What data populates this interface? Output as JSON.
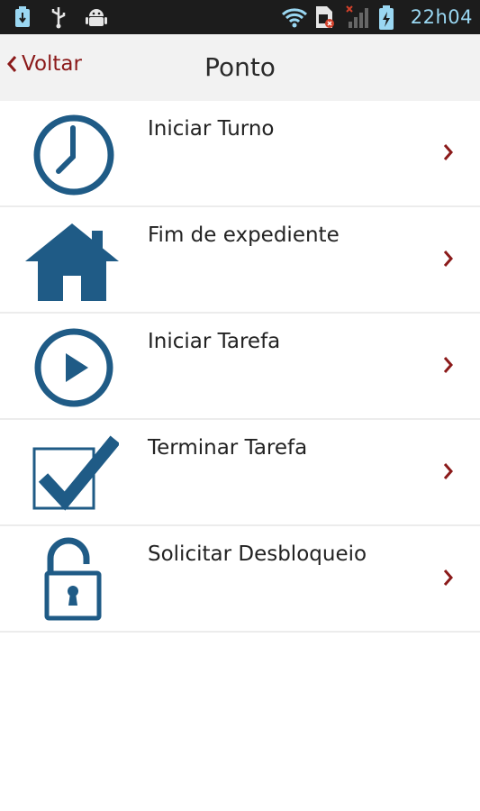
{
  "status_bar": {
    "time": "22h04",
    "icons": [
      "usb-storage-icon",
      "usb-icon",
      "android-debug-icon",
      "wifi-icon",
      "sim-error-icon",
      "signal-no-service-icon",
      "battery-charging-icon"
    ]
  },
  "header": {
    "back_label": "Voltar",
    "title": "Ponto"
  },
  "menu": {
    "items": [
      {
        "label": "Iniciar Turno",
        "icon": "clock-icon"
      },
      {
        "label": "Fim de expediente",
        "icon": "home-icon"
      },
      {
        "label": "Iniciar Tarefa",
        "icon": "play-icon"
      },
      {
        "label": "Terminar Tarefa",
        "icon": "checkbox-check-icon"
      },
      {
        "label": "Solicitar Desbloqueio",
        "icon": "unlock-icon"
      }
    ]
  },
  "colors": {
    "icon_blue": "#1f5b86",
    "accent_red": "#8b1a1a",
    "status_blue": "#9ad7f2"
  }
}
